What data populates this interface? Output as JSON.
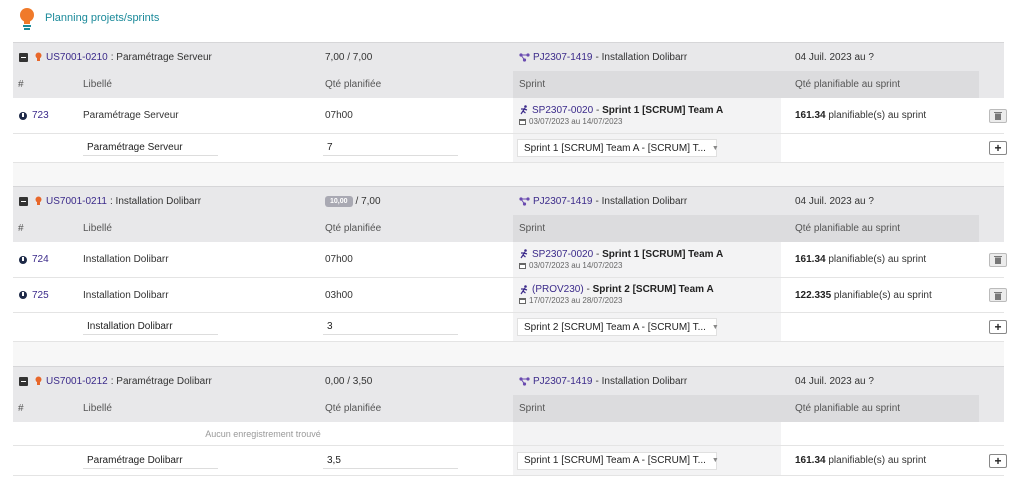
{
  "app": {
    "title": "Planning projets/sprints"
  },
  "headers": {
    "num": "#",
    "label": "Libellé",
    "qty": "Qté planifiée",
    "sprint": "Sprint",
    "qty_sprint": "Qté planifiable au sprint"
  },
  "groups": [
    {
      "ref": "US7001-0210",
      "title": ": Paramétrage Serveur",
      "qty_badge": "",
      "qty": "7,00 / 7,00",
      "project_ref": "PJ2307-1419",
      "project_title": "- Installation Dolibarr",
      "date": "04 Juil. 2023 au ?",
      "rows": [
        {
          "id": "723",
          "label": "Paramétrage Serveur",
          "qty": "07h00",
          "sprint_ref": "SP2307-0020",
          "sprint_sep": " - ",
          "sprint_name": "Sprint 1 [SCRUM] Team A",
          "sprint_dates": "03/07/2023 au 14/07/2023",
          "plan_value": "161.34",
          "plan_suffix": " planifiable(s) au sprint"
        }
      ],
      "form": {
        "label": "Paramétrage Serveur",
        "qty": "7",
        "sprint": "Sprint 1 [SCRUM] Team A - [SCRUM] T...",
        "plan_value": "",
        "plan_suffix": ""
      }
    },
    {
      "ref": "US7001-0211",
      "title": ": Installation Dolibarr",
      "qty_badge": "10,00",
      "qty": "/ 7,00",
      "project_ref": "PJ2307-1419",
      "project_title": "- Installation Dolibarr",
      "date": "04 Juil. 2023 au ?",
      "rows": [
        {
          "id": "724",
          "label": "Installation Dolibarr",
          "qty": "07h00",
          "sprint_ref": "SP2307-0020",
          "sprint_sep": " - ",
          "sprint_name": "Sprint 1 [SCRUM] Team A",
          "sprint_dates": "03/07/2023 au 14/07/2023",
          "plan_value": "161.34",
          "plan_suffix": " planifiable(s) au sprint"
        },
        {
          "id": "725",
          "label": "Installation Dolibarr",
          "qty": "03h00",
          "sprint_ref": "(PROV230)",
          "sprint_sep": " - ",
          "sprint_name": "Sprint 2 [SCRUM] Team A",
          "sprint_dates": "17/07/2023 au 28/07/2023",
          "plan_value": "122.335",
          "plan_suffix": " planifiable(s) au sprint"
        }
      ],
      "form": {
        "label": "Installation Dolibarr",
        "qty": "3",
        "sprint": "Sprint 2 [SCRUM] Team A - [SCRUM] T...",
        "plan_value": "",
        "plan_suffix": ""
      }
    },
    {
      "ref": "US7001-0212",
      "title": ": Paramétrage Dolibarr",
      "qty_badge": "",
      "qty": "0,00 / 3,50",
      "project_ref": "PJ2307-1419",
      "project_title": "- Installation Dolibarr",
      "date": "04 Juil. 2023 au ?",
      "empty_text": "Aucun enregistrement trouvé",
      "rows": [],
      "form": {
        "label": "Paramétrage Dolibarr",
        "qty": "3,5",
        "sprint": "Sprint 1 [SCRUM] Team A - [SCRUM] T...",
        "plan_value": "161.34",
        "plan_suffix": " planifiable(s) au sprint"
      }
    }
  ]
}
